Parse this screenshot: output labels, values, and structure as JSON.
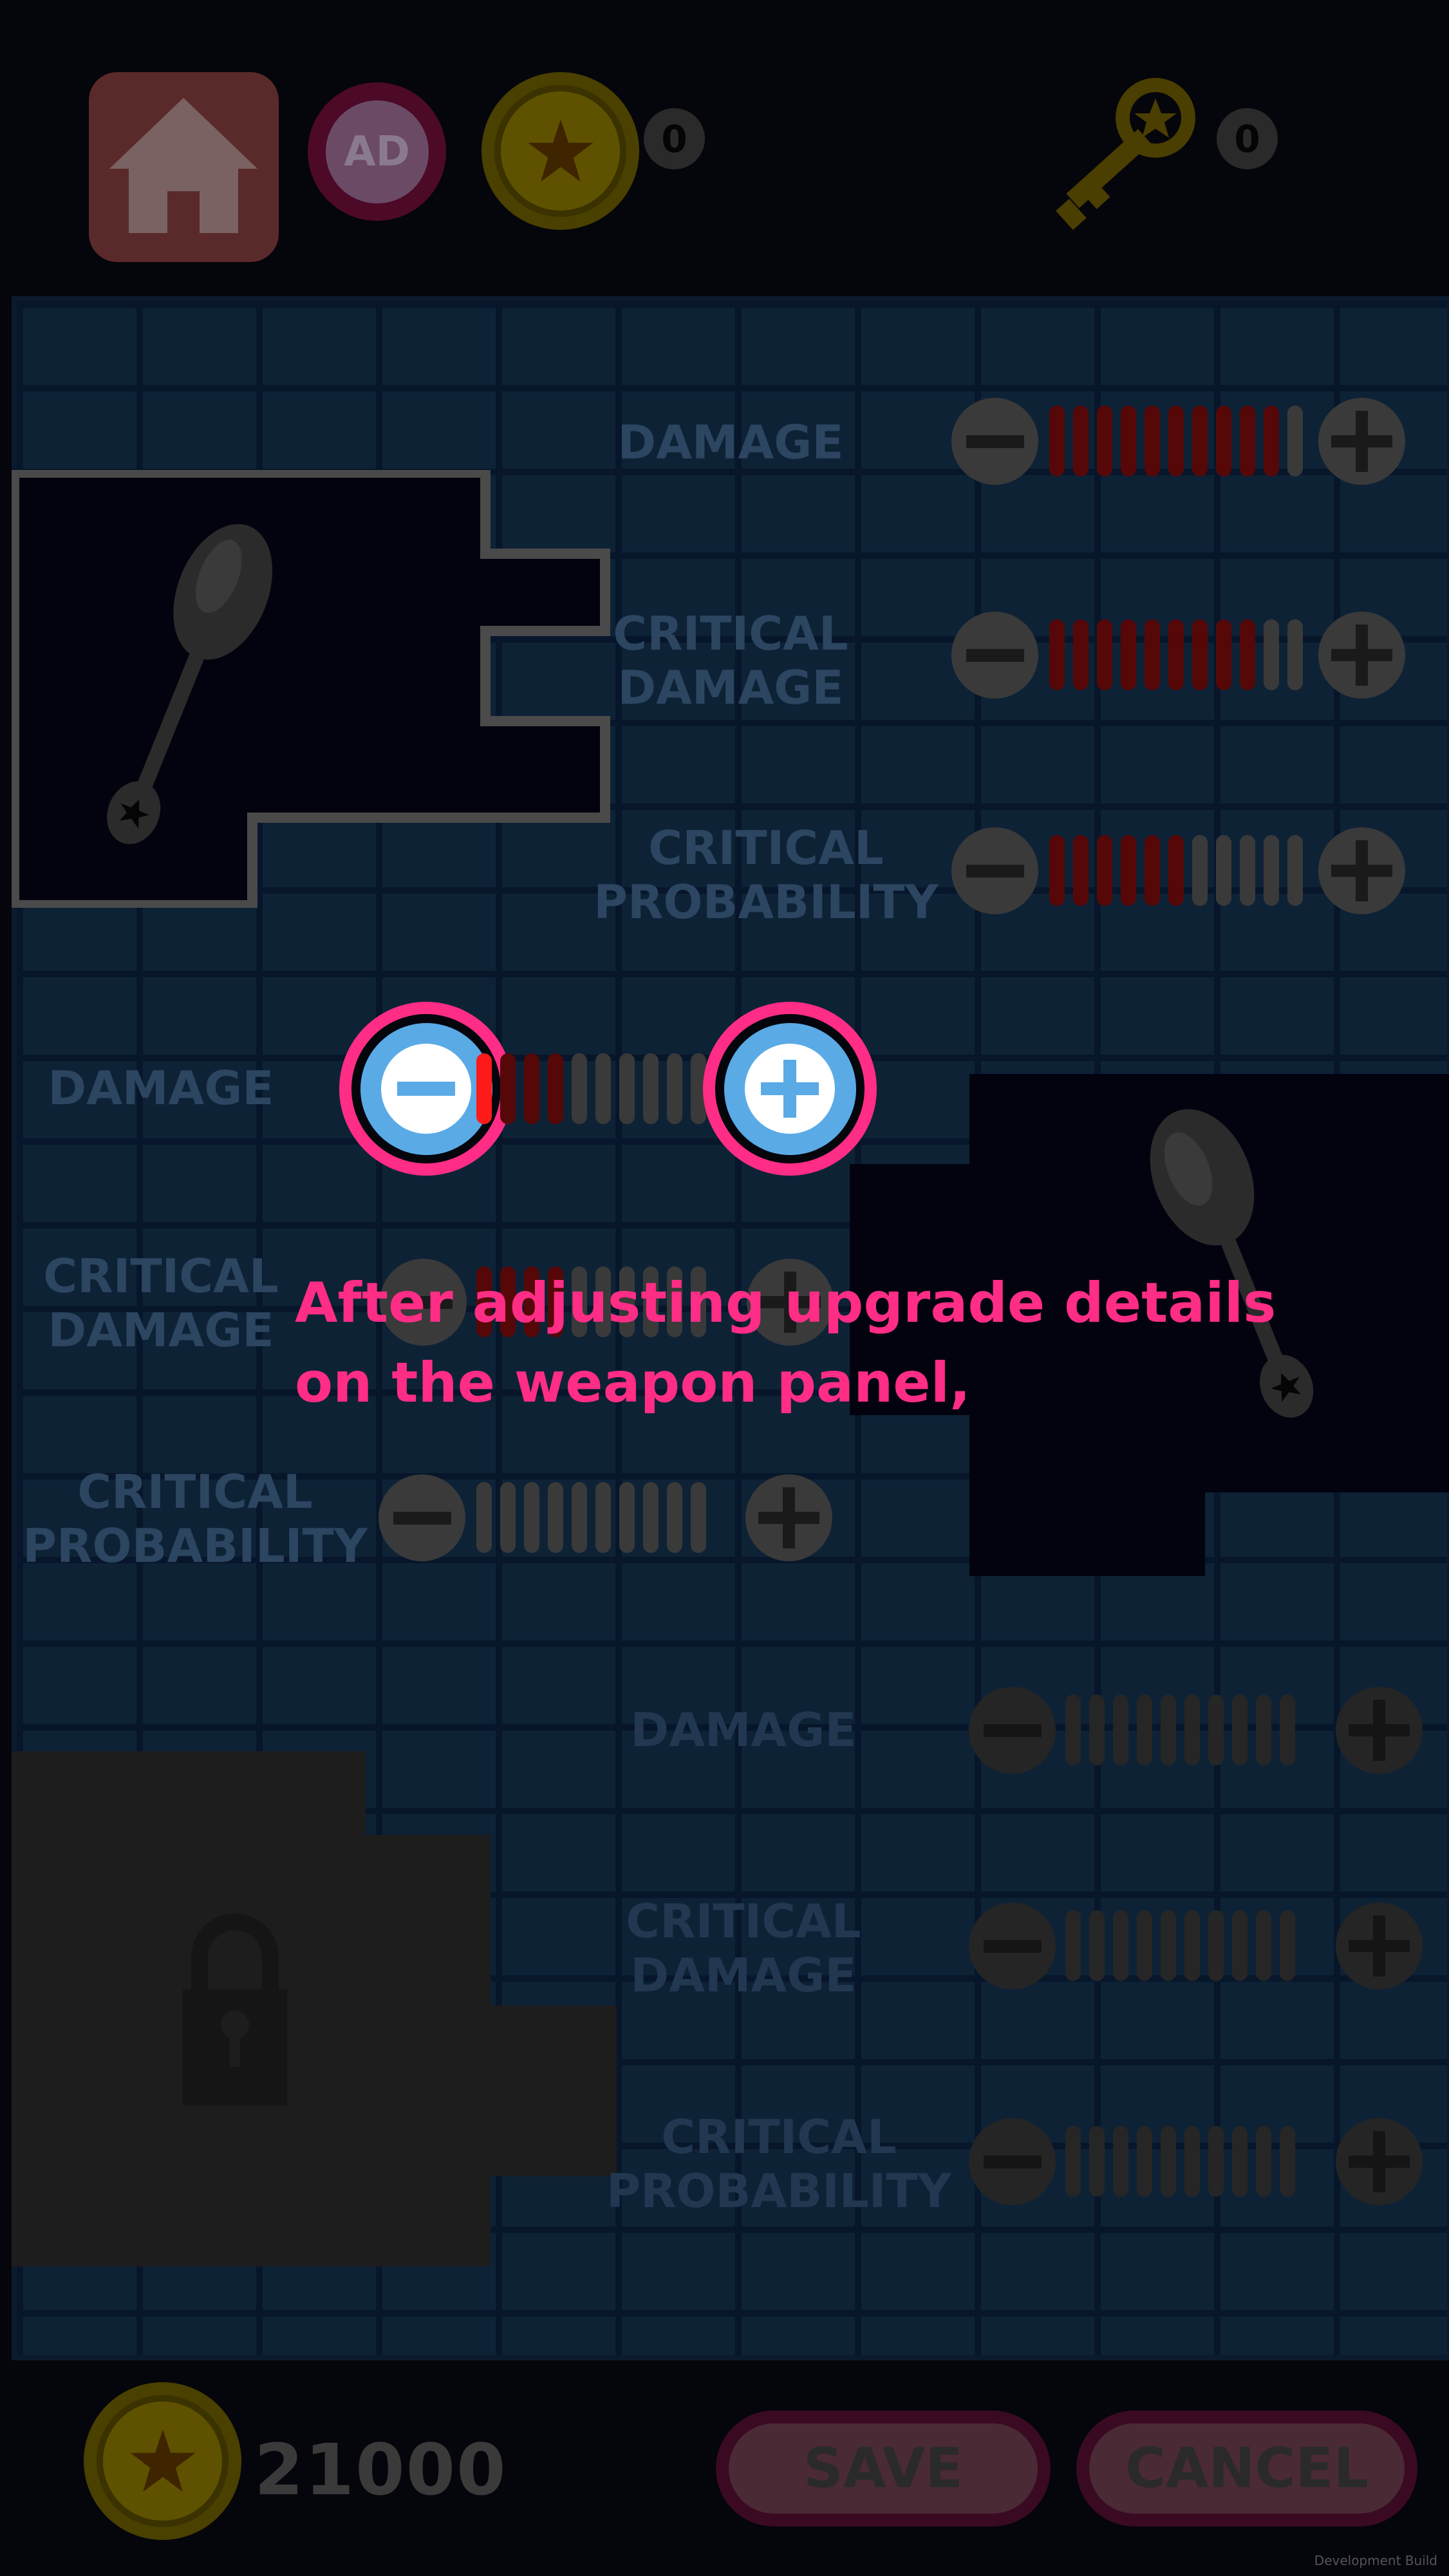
{
  "header": {
    "home_icon": "home-icon",
    "ad_label": "AD",
    "coin_count": "0",
    "key_count": "0"
  },
  "panels": [
    {
      "weapon_icon": "spoon-icon",
      "stats": [
        {
          "label": "DAMAGE",
          "level": 10,
          "max": 11
        },
        {
          "label": "CRITICAL\nDAMAGE",
          "level": 9,
          "max": 11
        },
        {
          "label": "CRITICAL\nPROBABILITY",
          "level": 6,
          "max": 11
        }
      ]
    },
    {
      "weapon_icon": "spoon-icon",
      "stats": [
        {
          "label": "DAMAGE",
          "level": 4,
          "max": 10
        },
        {
          "label": "CRITICAL\nDAMAGE",
          "level": 4,
          "max": 10
        },
        {
          "label": "CRITICAL\nPROBABILITY",
          "level": 0,
          "max": 10
        }
      ]
    },
    {
      "locked": true,
      "lock_icon": "lock-icon",
      "stats": [
        {
          "label": "DAMAGE",
          "level": 0,
          "max": 10
        },
        {
          "label": "CRITICAL\nDAMAGE",
          "level": 0,
          "max": 10
        },
        {
          "label": "CRITICAL\nPROBABILITY",
          "level": 0,
          "max": 10
        }
      ]
    }
  ],
  "tutorial": {
    "text": "After adjusting upgrade details\non the weapon panel,"
  },
  "footer": {
    "coins": "21000",
    "save_label": "SAVE",
    "cancel_label": "CANCEL"
  },
  "watermark": "Development Build",
  "colors": {
    "highlight": "#ff2d85",
    "button_blue": "#5aaae6",
    "bar_red": "#ff1a1a"
  }
}
